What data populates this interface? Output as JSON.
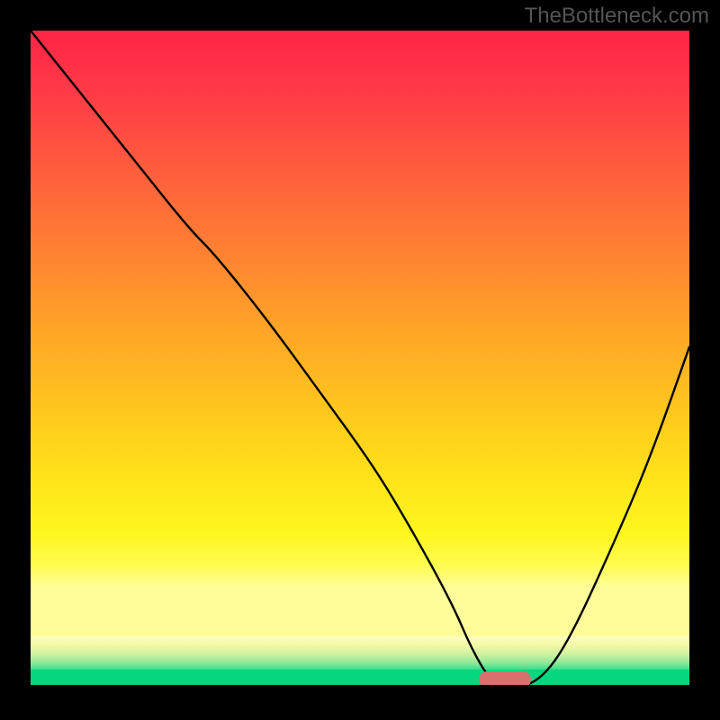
{
  "watermark": "TheBottleneck.com",
  "colors": {
    "top": "#ff2446",
    "mid": "#ffe31a",
    "green": "#05d77f",
    "marker": "#d9706d"
  },
  "chart_data": {
    "type": "line",
    "title": "",
    "xlabel": "",
    "ylabel": "",
    "xlim": [
      0,
      100
    ],
    "ylim": [
      0,
      100
    ],
    "x": [
      0,
      8,
      16,
      24,
      28,
      36,
      44,
      52,
      58,
      64,
      67,
      70,
      74,
      78,
      82,
      88,
      94,
      100
    ],
    "values": [
      100,
      90,
      80,
      70,
      66,
      56,
      45,
      34,
      24,
      13,
      6,
      1,
      0,
      2,
      8,
      21,
      35,
      52
    ],
    "sweet_spot_x": 72,
    "background_gradient": [
      "red",
      "orange",
      "yellow",
      "green"
    ],
    "marker_color": "#d9706d"
  }
}
